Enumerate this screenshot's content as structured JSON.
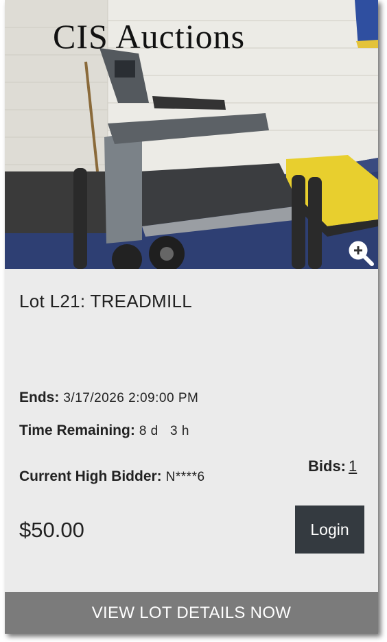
{
  "photo": {
    "brand_text": "CIS Auctions",
    "zoom_icon": "zoom-in-icon"
  },
  "lot": {
    "title": "Lot L21: TREADMILL",
    "ends_label": "Ends:",
    "ends_value": "3/17/2026 2:09:00 PM",
    "time_remaining_label": "Time Remaining:",
    "time_remaining_value": "8 d   3 h",
    "high_bidder_label": "Current High Bidder:",
    "high_bidder_value": "N****6",
    "bids_label": "Bids:",
    "bids_value": "1",
    "price": "$50.00"
  },
  "actions": {
    "login_label": "Login",
    "details_label": "VIEW LOT DETAILS NOW"
  },
  "colors": {
    "card_bg": "#ebebeb",
    "login_bg": "#343a40",
    "details_bg": "#7b7b7b"
  }
}
